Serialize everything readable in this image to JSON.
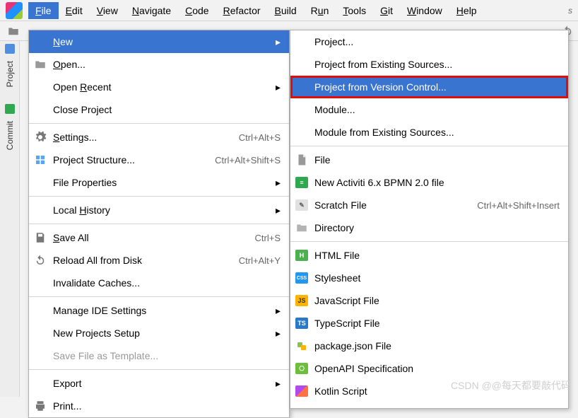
{
  "menubar": {
    "items": [
      "File",
      "Edit",
      "View",
      "Navigate",
      "Code",
      "Refactor",
      "Build",
      "Run",
      "Tools",
      "Git",
      "Window",
      "Help"
    ],
    "active_index": 0,
    "search_hint": "s"
  },
  "left_tabs": {
    "project": "Project",
    "commit": "Commit"
  },
  "file_menu": {
    "new": "New",
    "open": "Open...",
    "open_recent": "Open Recent",
    "close_project": "Close Project",
    "settings": "Settings...",
    "settings_sc": "Ctrl+Alt+S",
    "proj_struct": "Project Structure...",
    "proj_struct_sc": "Ctrl+Alt+Shift+S",
    "file_props": "File Properties",
    "local_history": "Local History",
    "save_all": "Save All",
    "save_all_sc": "Ctrl+S",
    "reload": "Reload All from Disk",
    "reload_sc": "Ctrl+Alt+Y",
    "invalidate": "Invalidate Caches...",
    "manage_ide": "Manage IDE Settings",
    "new_proj_setup": "New Projects Setup",
    "save_tpl": "Save File as Template...",
    "export": "Export",
    "print": "Print..."
  },
  "new_menu": {
    "project": "Project...",
    "proj_existing": "Project from Existing Sources...",
    "proj_vcs": "Project from Version Control...",
    "module": "Module...",
    "module_existing": "Module from Existing Sources...",
    "file": "File",
    "activiti": "New Activiti 6.x BPMN 2.0 file",
    "scratch": "Scratch File",
    "scratch_sc": "Ctrl+Alt+Shift+Insert",
    "directory": "Directory",
    "html": "HTML File",
    "css": "Stylesheet",
    "js": "JavaScript File",
    "ts": "TypeScript File",
    "pkgjson": "package.json File",
    "openapi": "OpenAPI Specification",
    "kotlin": "Kotlin Script"
  },
  "watermark": "CSDN @@每天都要敲代码"
}
